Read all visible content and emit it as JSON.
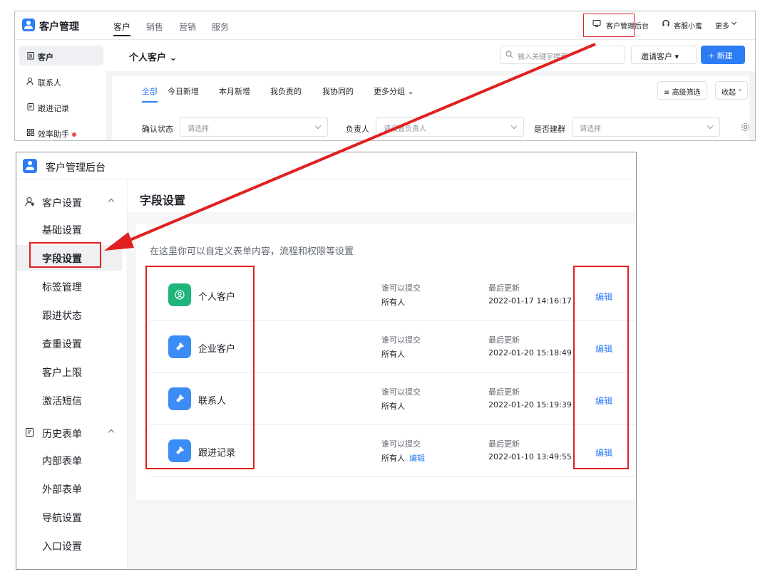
{
  "top": {
    "app_title": "客户管理",
    "nav_tabs": [
      "客户",
      "销售",
      "营销",
      "服务"
    ],
    "admin_label": "客户管理后台",
    "service_label": "客服小蜜",
    "more_label": "更多",
    "sidebar": [
      "客户",
      "联系人",
      "跟进记录",
      "效率助手"
    ],
    "view_title": "个人客户",
    "search_placeholder": "输入关键字搜索",
    "invite_label": "邀请客户",
    "new_label": "+ 新建",
    "filter_tabs": [
      "全部",
      "今日新增",
      "本月新增",
      "我负责的",
      "我协同的",
      "更多分组"
    ],
    "advanced_filter": "高级筛选",
    "collapse": "收起",
    "filters": [
      {
        "label": "确认状态",
        "placeholder": "请选择"
      },
      {
        "label": "负责人",
        "placeholder": "请设置负责人"
      },
      {
        "label": "是否建群",
        "placeholder": "请选择"
      }
    ]
  },
  "bottom": {
    "title": "客户管理后台",
    "groups": [
      {
        "label": "客户设置",
        "items": [
          "基础设置",
          "字段设置",
          "标签管理",
          "跟进状态",
          "查重设置",
          "客户上限",
          "激活短信"
        ]
      },
      {
        "label": "历史表单",
        "items": [
          "内部表单",
          "外部表单",
          "导航设置",
          "入口设置"
        ]
      }
    ],
    "page_title": "字段设置",
    "description": "在这里你可以自定义表单内容，流程和权限等设置",
    "who_label": "谁可以提交",
    "update_label": "最后更新",
    "edit_label": "编辑",
    "forms": [
      {
        "name": "个人客户",
        "who": "所有人",
        "updated": "2022-01-17 14:16:17",
        "icon": "person-icon"
      },
      {
        "name": "企业客户",
        "who": "所有人",
        "updated": "2022-01-20 15:18:49",
        "icon": "form-icon"
      },
      {
        "name": "联系人",
        "who": "所有人",
        "updated": "2022-01-20 15:19:39",
        "icon": "form-icon"
      },
      {
        "name": "跟进记录",
        "who": "所有人",
        "who_edit": "编辑",
        "updated": "2022-01-10 13:49:55",
        "icon": "form-icon"
      }
    ]
  },
  "colors": {
    "accent": "#2d7cf6",
    "annotation": "#e02020",
    "green": "#1fb57a"
  }
}
